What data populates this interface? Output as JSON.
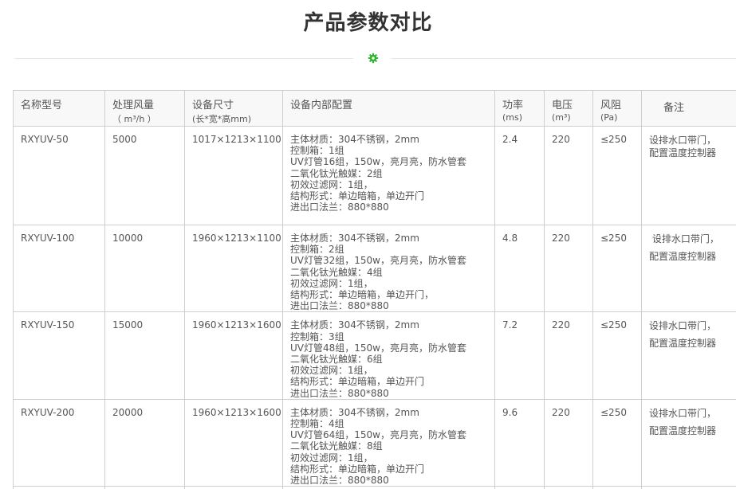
{
  "page": {
    "title": "产品参数对比",
    "accent_color": "#2db52d"
  },
  "table": {
    "headers": {
      "model": {
        "label": "名称型号",
        "sub": ""
      },
      "airflow": {
        "label": "处理风量",
        "sub": "（ m³/h ）"
      },
      "size": {
        "label": "设备尺寸",
        "sub": "(长*宽*高mm)"
      },
      "config": {
        "label": "设备内部配置",
        "sub": ""
      },
      "power": {
        "label": "功率",
        "sub": "(ms)"
      },
      "voltage": {
        "label": "电压",
        "sub": "(m³)"
      },
      "resistance": {
        "label": "风阻",
        "sub": "(Pa)"
      },
      "note": {
        "label": "备注",
        "sub": ""
      }
    },
    "rows": [
      {
        "model": "RXYUV-50",
        "airflow": "5000",
        "size": "1017×1213×1100",
        "config": [
          "主体材质：304不锈钢，2mm",
          "控制箱：1组",
          "UV灯管16组，150w，亮月亮，防水管套",
          "二氧化钛光触媒：2组",
          "初效过滤网：1组，",
          "结构形式：单边暗箱，单边开门",
          "进出口法兰：880*880"
        ],
        "power": "2.4",
        "voltage": "220",
        "resistance": "≤250",
        "note": [
          "设排水口带门，",
          "配置温度控制器"
        ]
      },
      {
        "model": "RXYUV-100",
        "airflow": "10000",
        "size": "1960×1213×1100",
        "config": [
          "主体材质：304不锈钢，2mm",
          "控制箱：2组",
          "UV灯管32组，150w，亮月亮，防水管套",
          "二氧化钛光触媒：4组",
          "初效过滤网：1组，",
          "结构形式：单边暗箱，单边开门，",
          "进出口法兰：880*880"
        ],
        "power": "4.8",
        "voltage": "220",
        "resistance": "≤250",
        "note": [
          " 设排水口带门，",
          "配置温度控制器"
        ]
      },
      {
        "model": "RXYUV-150",
        "airflow": "15000",
        "size": "1960×1213×1600",
        "config": [
          "主体材质：304不锈钢，2mm",
          "控制箱：3组",
          "UV灯管48组，150w，亮月亮，防水管套",
          "二氧化钛光触媒：6组",
          "初效过滤网：1组，",
          "结构形式：单边暗箱，单边开门",
          "进出口法兰：880*880"
        ],
        "power": "7.2",
        "voltage": "220",
        "resistance": "≤250",
        "note": [
          "设排水口带门，",
          "配置温度控制器"
        ]
      },
      {
        "model": "RXYUV-200",
        "airflow": "20000",
        "size": "1960×1213×1600",
        "config": [
          "主体材质：304不锈钢，2mm",
          "控制箱：4组",
          "UV灯管64组，150w，亮月亮，防水管套",
          "二氧化钛光触媒：8组",
          "初效过滤网：1组，",
          "结构形式：单边暗箱，单边开门",
          "进出口法兰：880*880"
        ],
        "power": "9.6",
        "voltage": "220",
        "resistance": "≤250",
        "note": [
          "设排水口带门，",
          "配置温度控制器"
        ]
      }
    ]
  },
  "icons": {
    "divider": "gear-icon"
  }
}
